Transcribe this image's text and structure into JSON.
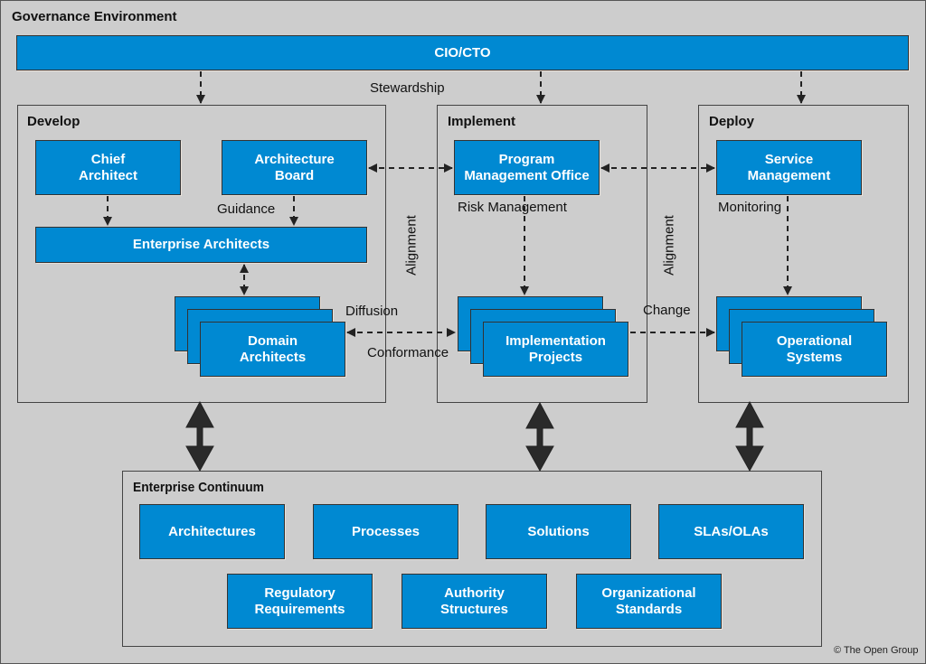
{
  "diagram": {
    "governance_title": "Governance Environment",
    "cio_cto": "CIO/CTO",
    "stewardship": "Stewardship",
    "panels": {
      "develop": {
        "title": "Develop",
        "chief_architect": "Chief\nArchitect",
        "architecture_board": "Architecture\nBoard",
        "guidance": "Guidance",
        "enterprise_architects": "Enterprise Architects",
        "domain_architects": "Domain\nArchitects"
      },
      "implement": {
        "title": "Implement",
        "program_management_office": "Program\nManagement Office",
        "risk_management": "Risk Management",
        "implementation_projects": "Implementation\nProjects"
      },
      "deploy": {
        "title": "Deploy",
        "service_management": "Service\nManagement",
        "monitoring": "Monitoring",
        "operational_systems": "Operational\nSystems"
      }
    },
    "connector_labels": {
      "alignment_left": "Alignment",
      "alignment_right": "Alignment",
      "diffusion": "Diffusion",
      "conformance": "Conformance",
      "change": "Change"
    },
    "enterprise_continuum": {
      "title": "Enterprise Continuum",
      "row1": [
        "Architectures",
        "Processes",
        "Solutions",
        "SLAs/OLAs"
      ],
      "row2": [
        "Regulatory\nRequirements",
        "Authority\nStructures",
        "Organizational\nStandards"
      ]
    },
    "copyright": "© The Open Group"
  },
  "colors": {
    "box_fill": "#0089d2",
    "background": "#cdcdcd",
    "arrow": "#222222"
  }
}
